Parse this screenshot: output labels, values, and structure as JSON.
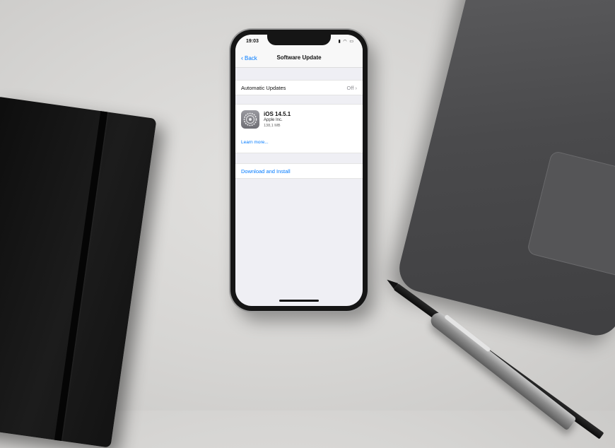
{
  "status_bar": {
    "time": "19:03",
    "icons": "▮ ◠ ▭"
  },
  "nav": {
    "back_label": "Back",
    "title": "Software Update"
  },
  "automatic_updates": {
    "label": "Automatic Updates",
    "value": "Off ›"
  },
  "update": {
    "name": "iOS 14.5.1",
    "vendor": "Apple Inc.",
    "size": "138,1 MB",
    "learn_more": "Learn more..."
  },
  "download": {
    "label": "Download and Install"
  },
  "colors": {
    "link_blue": "#007aff",
    "grouped_background": "#efeff4"
  }
}
